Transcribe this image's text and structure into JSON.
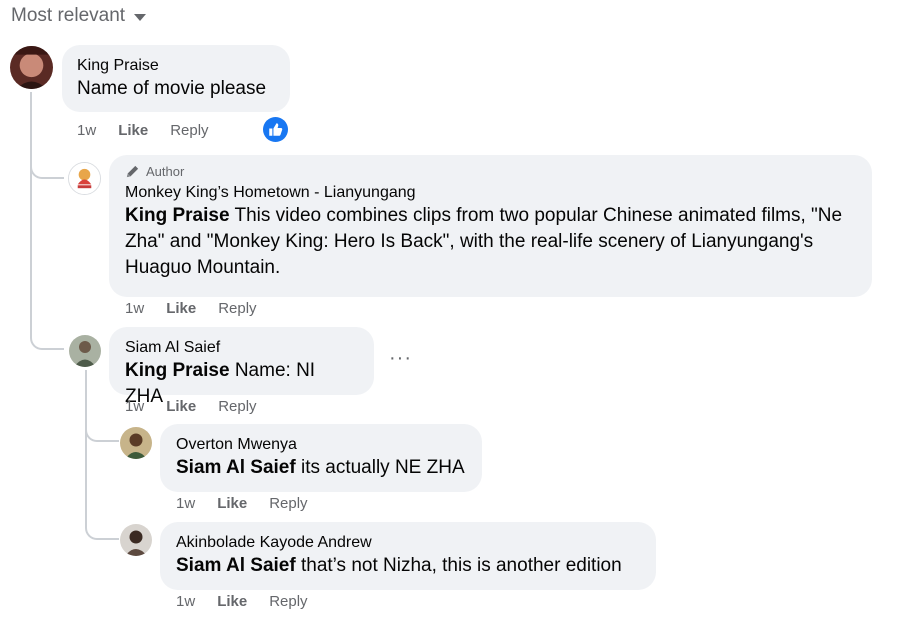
{
  "sort": {
    "label": "Most relevant",
    "icon": "caret-down-icon"
  },
  "comments": [
    {
      "author": "King Praise",
      "text": "Name of movie please",
      "time": "1w",
      "like": "Like",
      "reply": "Reply"
    },
    {
      "badge": "Author",
      "author": "Monkey King’s Hometown - Lianyungang",
      "mention": "King Praise",
      "text": "This video combines clips from two popular Chinese animated films, \"Ne Zha\" and \"Monkey King: Hero Is Back\", with the real-life scenery of Lianyungang's Huaguo Mountain.",
      "time": "1w",
      "like": "Like",
      "reply": "Reply"
    },
    {
      "author": "Siam Al Saief",
      "mention": "King Praise",
      "text": "Name: NI ZHA",
      "time": "1w",
      "like": "Like",
      "reply": "Reply",
      "more": "···"
    },
    {
      "author": "Overton Mwenya",
      "mention": "Siam Al Saief",
      "text": "its actually NE ZHA",
      "time": "1w",
      "like": "Like",
      "reply": "Reply"
    },
    {
      "author": "Akinbolade Kayode Andrew",
      "mention": "Siam Al Saief",
      "text": "that’s not Nizha, this is another edition",
      "time": "1w",
      "like": "Like",
      "reply": "Reply"
    }
  ],
  "colors": {
    "bubble": "#f0f2f5",
    "like_reaction": "#1877f2",
    "muted": "#65676b"
  }
}
